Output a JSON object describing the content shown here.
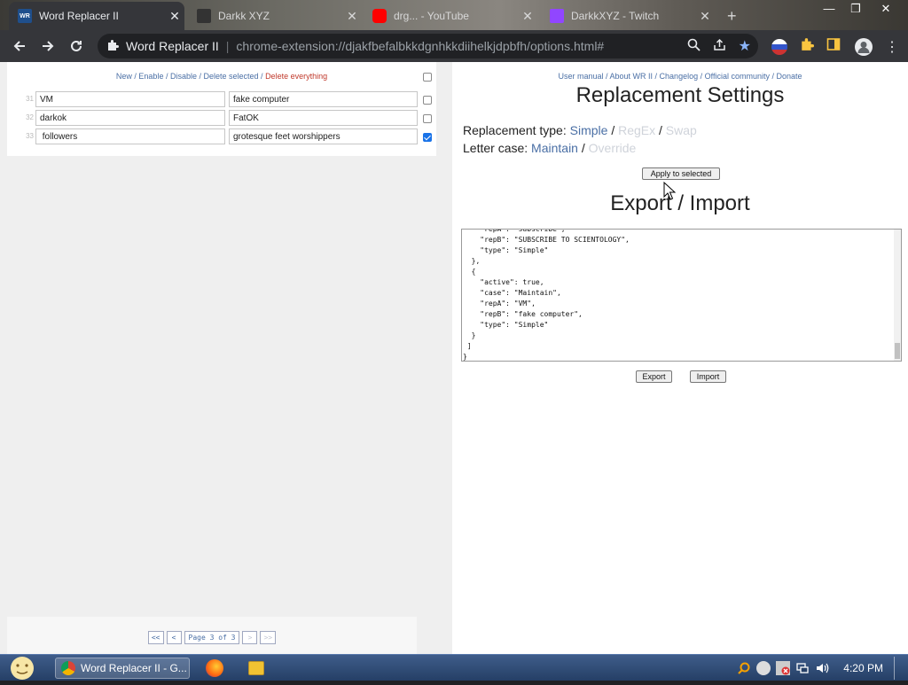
{
  "browser": {
    "tabs": [
      {
        "title": "Word Replacer II",
        "active": true,
        "favicon": "wr-icon"
      },
      {
        "title": "Darkk XYZ",
        "active": false,
        "favicon": "creature-icon"
      },
      {
        "title": "drg... - YouTube",
        "active": false,
        "favicon": "youtube-icon"
      },
      {
        "title": "DarkkXYZ - Twitch",
        "active": false,
        "favicon": "twitch-icon"
      }
    ],
    "new_tab": "+",
    "omnibox": {
      "site": "Word Replacer II",
      "url": "chrome-extension://djakfbefalbkkdgnhkkdiihelkjdpbfh/options.html#"
    }
  },
  "left": {
    "toplinks": {
      "new": "New",
      "enable": "Enable",
      "disable": "Disable",
      "delete_selected": "Delete selected",
      "delete_everything": "Delete everything",
      "sep": " / "
    },
    "rows": [
      {
        "num": "31",
        "repA": "VM",
        "repB": "fake computer",
        "checked": false
      },
      {
        "num": "32",
        "repA": "darkok",
        "repB": "FatOK",
        "checked": false
      },
      {
        "num": "33",
        "repA": " followers",
        "repB": "grotesque feet worshippers",
        "checked": true
      }
    ],
    "pager": {
      "first": "<<",
      "prev": "<",
      "page": "Page 3 of 3",
      "next": ">",
      "last": ">>"
    }
  },
  "right": {
    "links": {
      "manual": "User manual",
      "about": "About WR II",
      "changelog": "Changelog",
      "community": "Official community",
      "donate": "Donate",
      "sep": " / "
    },
    "settings_title": "Replacement Settings",
    "replacement_type_label": "Replacement type:",
    "type_simple": "Simple",
    "type_regex": "RegEx",
    "type_swap": "Swap",
    "letter_case_label": "Letter case:",
    "case_maintain": "Maintain",
    "case_override": "Override",
    "slash": "/",
    "apply_button": "Apply to selected",
    "export_title": "Export / Import",
    "json_text": "    \"repA\": \"subscribe\",\n    \"repB\": \"SUBSCRIBE TO SCIENTOLOGY\",\n    \"type\": \"Simple\"\n  },\n  {\n    \"active\": true,\n    \"case\": \"Maintain\",\n    \"repA\": \"VM\",\n    \"repB\": \"fake computer\",\n    \"type\": \"Simple\"\n  }\n ]\n}",
    "export_button": "Export",
    "import_button": "Import"
  },
  "taskbar": {
    "chrome_item": "Word Replacer II - G...",
    "clock": "4:20 PM"
  }
}
